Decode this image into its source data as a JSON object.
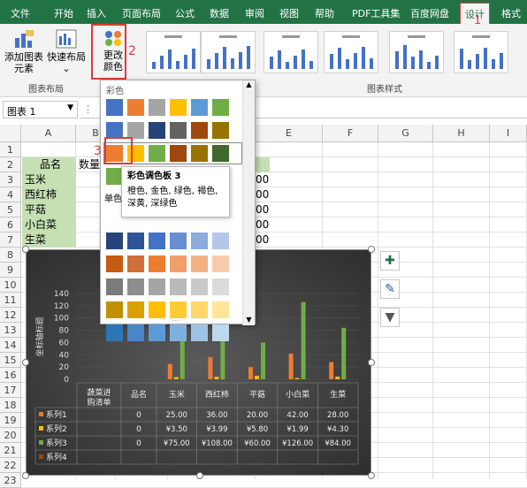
{
  "menu": {
    "tabs": [
      "文件",
      "开始",
      "插入",
      "页面布局",
      "公式",
      "数据",
      "审阅",
      "视图",
      "帮助",
      "PDF工具集",
      "百度网盘",
      "设计",
      "格式"
    ],
    "active_index": 11
  },
  "ribbon": {
    "add_chart_element": "添加图表元素",
    "quick_layout": "快速布局",
    "change_color": "更改颜色",
    "group_layout": "图表布局",
    "group_style": "图表样式"
  },
  "annotations": {
    "one": "1",
    "two": "2",
    "three": "3"
  },
  "namebox": {
    "value": "图表 1"
  },
  "columns": [
    "A",
    "B",
    "C",
    "D",
    "E",
    "F",
    "G",
    "H",
    "I"
  ],
  "rows": [
    "1",
    "2",
    "3",
    "4",
    "5",
    "6",
    "7",
    "8",
    "9",
    "10",
    "11",
    "12",
    "13",
    "14",
    "15",
    "16",
    "17",
    "18",
    "19",
    "20",
    "21",
    "22",
    "23"
  ],
  "sheet": {
    "header_a": "品名",
    "header_b": "数量",
    "items": [
      "玉米",
      "西红柿",
      "平菇",
      "小白菜",
      "生菜"
    ],
    "d_values": [
      "00",
      "00",
      "00",
      "00",
      "00"
    ]
  },
  "palette": {
    "title": "彩色",
    "mono_label": "单色",
    "colorful_rows": [
      [
        "#4472c4",
        "#ed7d31",
        "#a5a5a5",
        "#ffc000",
        "#5b9bd5",
        "#70ad47"
      ],
      [
        "#4472c4",
        "#a5a5a5",
        "#264478",
        "#636363",
        "#9e480e",
        "#997300"
      ],
      [
        "#ed7d31",
        "#ffc000",
        "#70ad47",
        "#9e480e",
        "#997300",
        "#43682b"
      ],
      [
        "#70ad47",
        "#4472c4",
        "#ffc000",
        "#43682b",
        "#698ed0",
        "#997300"
      ]
    ],
    "mono_rows": [
      [
        "#264478",
        "#2e5597",
        "#4472c4",
        "#698ed0",
        "#8faadc",
        "#b4c7e7"
      ],
      [
        "#c55a11",
        "#d0703a",
        "#ed7d31",
        "#f29e6d",
        "#f4b183",
        "#f8cbad"
      ],
      [
        "#7b7b7b",
        "#8e8e8e",
        "#a5a5a5",
        "#bababa",
        "#c9c9c9",
        "#dbdbdb"
      ],
      [
        "#bf9000",
        "#d9a100",
        "#ffc000",
        "#ffcd33",
        "#ffd966",
        "#ffe699"
      ],
      [
        "#2e75b6",
        "#4a86c5",
        "#5b9bd5",
        "#7eb0dd",
        "#9dc3e6",
        "#bdd7ee"
      ]
    ]
  },
  "tooltip": {
    "title": "彩色调色板 3",
    "desc": "橙色, 金色, 绿色, 褐色, 深黄, 深绿色"
  },
  "chart_data": {
    "type": "bar",
    "categories": [
      "玉米",
      "西红柿",
      "平菇",
      "小白菜",
      "生菜"
    ],
    "ylabel": "坐标轴标题",
    "ylim": [
      0,
      140
    ],
    "yticks": [
      "140",
      "120",
      "100",
      "80",
      "60",
      "40",
      "20",
      "0"
    ],
    "table_header": "蔬菜进购清单",
    "table_col_label": "品名",
    "series": [
      {
        "name": "系列1",
        "color": "#ed7d31",
        "values": [
          25,
          36,
          20,
          42,
          28
        ],
        "labels": [
          "25.00",
          "36.00",
          "20.00",
          "42.00",
          "28.00"
        ],
        "col0": "0"
      },
      {
        "name": "系列2",
        "color": "#ffc000",
        "values": [
          3.5,
          3.99,
          5.8,
          1.99,
          4.3
        ],
        "labels": [
          "¥3.50",
          "¥3.99",
          "¥5.80",
          "¥1.99",
          "¥4.30"
        ],
        "col0": "0"
      },
      {
        "name": "系列3",
        "color": "#70ad47",
        "values": [
          75,
          108,
          60,
          126,
          84
        ],
        "labels": [
          "¥75.00",
          "¥108.00",
          "¥60.00",
          "¥126.00",
          "¥84.00"
        ],
        "col0": "0"
      },
      {
        "name": "系列4",
        "color": "#9e480e",
        "values": [],
        "labels": [],
        "col0": ""
      }
    ]
  }
}
